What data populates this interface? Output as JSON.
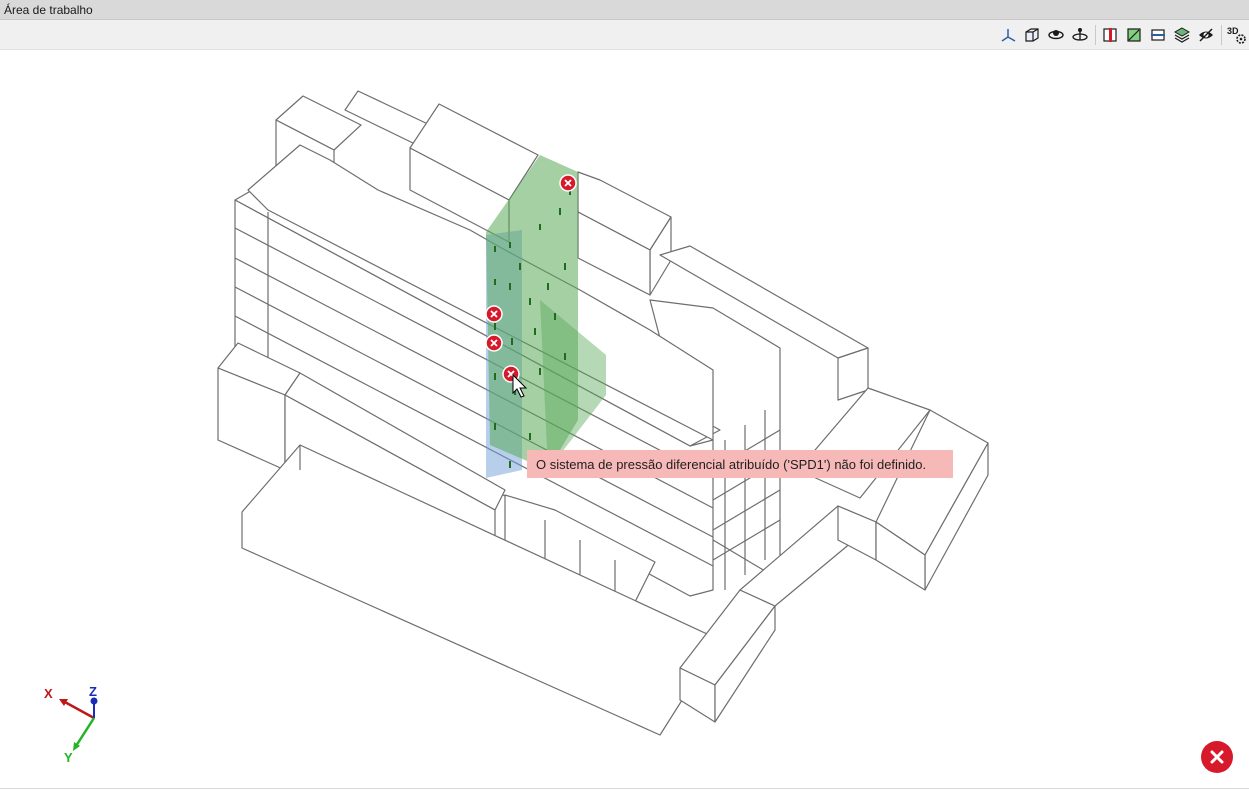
{
  "window": {
    "title": "Área de trabalho"
  },
  "toolbar": {
    "buttons": [
      {
        "name": "axes-view-icon"
      },
      {
        "name": "cube-view-icon"
      },
      {
        "name": "orbit-view-icon"
      },
      {
        "name": "rotate-view-icon"
      },
      {
        "name": "section-x-icon"
      },
      {
        "name": "section-y-icon"
      },
      {
        "name": "section-z-icon"
      },
      {
        "name": "layers-icon"
      },
      {
        "name": "visibility-icon"
      },
      {
        "name": "3d-settings-icon"
      }
    ],
    "label_3d": "3D"
  },
  "tooltip": {
    "text": "O sistema de pressão diferencial atribuído ('SPD1') não foi definido."
  },
  "axes": {
    "x": "X",
    "y": "Y",
    "z": "Z"
  },
  "colors": {
    "error": "#d61a2b",
    "tooltip_bg": "#f7b8b8",
    "stair_green": "#5aa95a",
    "stair_blue": "#6f9fd8",
    "outline": "#6e6e6e"
  }
}
